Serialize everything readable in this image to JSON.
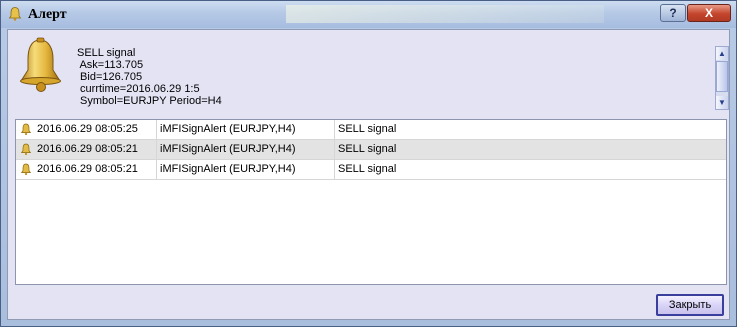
{
  "window": {
    "title": "Алерт",
    "background_title": "",
    "help_label": "?",
    "close_label": "X"
  },
  "message": {
    "lines": [
      "SELL signal",
      " Ask=113.705",
      " Bid=126.705",
      " currtime=2016.06.29 1:5",
      " Symbol=EURJPY Period=H4"
    ]
  },
  "alerts": [
    {
      "time": "2016.06.29 08:05:25",
      "source": "iMFISignAlert (EURJPY,H4)",
      "message": "SELL signal",
      "selected": false
    },
    {
      "time": "2016.06.29 08:05:21",
      "source": "iMFISignAlert (EURJPY,H4)",
      "message": "SELL signal",
      "selected": true
    },
    {
      "time": "2016.06.29 08:05:21",
      "source": "iMFISignAlert (EURJPY,H4)",
      "message": "SELL signal",
      "selected": false
    }
  ],
  "buttons": {
    "close": "Закрыть"
  },
  "icons": {
    "title": "bell-icon",
    "message": "bell-icon",
    "row": "bell-icon"
  },
  "colors": {
    "client_bg": "#e4e3f4",
    "selected_row": "#e3e3e3",
    "bell_gold": "#e0b53a"
  }
}
